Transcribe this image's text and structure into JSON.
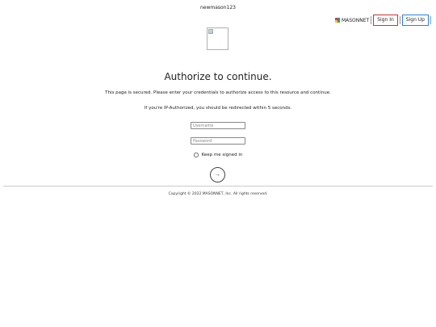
{
  "header": {
    "username": "newmason123"
  },
  "topbar": {
    "brand_name": "MASONNET",
    "brand_icon": "masonnet-logo-icon",
    "signin_label": "Sign In",
    "signup_label": "Sign Up",
    "signin_color": "#d32f2f",
    "signup_color": "#1e88e5"
  },
  "main": {
    "logo_icon": "broken-image-icon",
    "title": "Authorize to continue.",
    "message_secured": "This page is secured. Please enter your credentials to authorize access to this resource and continue.",
    "message_ip": "If you're IP-Authorized, you should be redirected within 5 seconds.",
    "username_placeholder": "Username",
    "username_value": "",
    "password_placeholder": "Password",
    "password_value": "",
    "remember_label": "Keep me signed in",
    "remember_checked": false,
    "submit_label": "→"
  },
  "footer": {
    "copyright": "Copyright © 2022 MASONNET, Inc. All rights reserved."
  }
}
